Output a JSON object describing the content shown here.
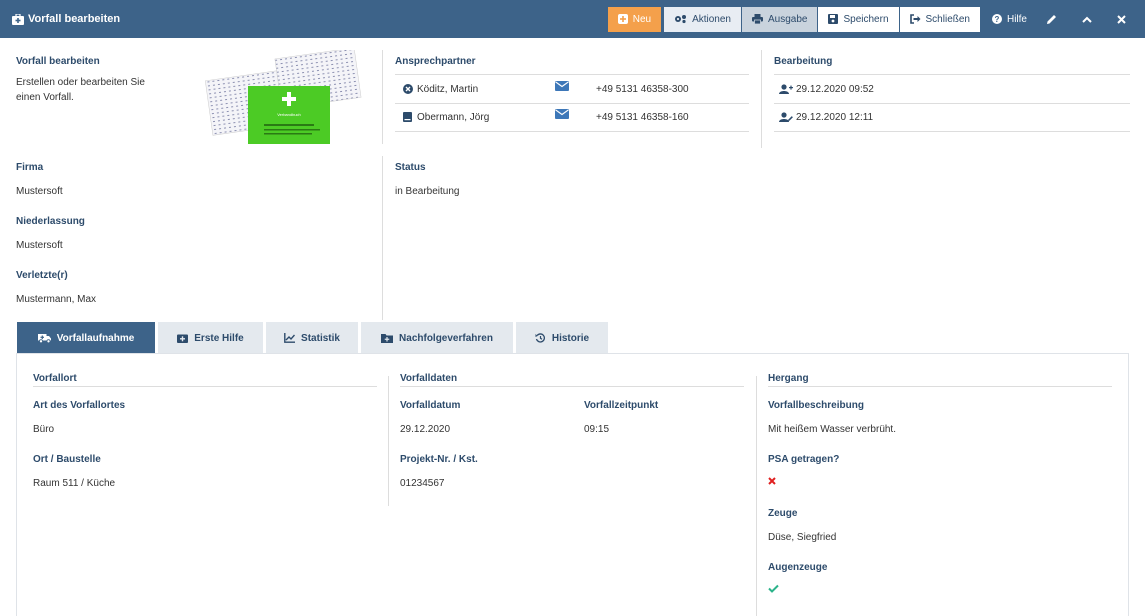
{
  "window": {
    "title": "Vorfall bearbeiten"
  },
  "toolbar": {
    "new_label": "Neu",
    "actions_label": "Aktionen",
    "output_label": "Ausgabe",
    "save_label": "Speichern",
    "close_label": "Schließen",
    "help_label": "Hilfe"
  },
  "intro": {
    "heading": "Vorfall bearbeiten",
    "description": "Erstellen oder bearbeiten Sie einen Vorfall.",
    "book_label": "Verbandbuch"
  },
  "contacts": {
    "heading": "Ansprechpartner",
    "items": [
      {
        "name": "Köditz, Martin",
        "phone": "+49 5131 46358-300"
      },
      {
        "name": "Obermann, Jörg",
        "phone": "+49 5131 46358-160"
      }
    ]
  },
  "editing": {
    "heading": "Bearbeitung",
    "created": "29.12.2020 09:52",
    "modified": "29.12.2020 12:11"
  },
  "company": {
    "firma_label": "Firma",
    "firma_value": "Mustersoft",
    "niederlassung_label": "Niederlassung",
    "niederlassung_value": "Mustersoft",
    "verletzte_label": "Verletzte(r)",
    "verletzte_value": "Mustermann, Max"
  },
  "status": {
    "label": "Status",
    "value": "in Bearbeitung"
  },
  "tabs": [
    {
      "label": "Vorfallaufnahme"
    },
    {
      "label": "Erste Hilfe"
    },
    {
      "label": "Statistik"
    },
    {
      "label": "Nachfolgeverfahren"
    },
    {
      "label": "Historie"
    }
  ],
  "vorfallort": {
    "heading": "Vorfallort",
    "art_label": "Art des Vorfallortes",
    "art_value": "Büro",
    "ort_label": "Ort / Baustelle",
    "ort_value": "Raum 511 / Küche"
  },
  "vorfalldaten": {
    "heading": "Vorfalldaten",
    "datum_label": "Vorfalldatum",
    "datum_value": "29.12.2020",
    "zeit_label": "Vorfallzeitpunkt",
    "zeit_value": "09:15",
    "projekt_label": "Projekt-Nr. / Kst.",
    "projekt_value": "01234567"
  },
  "hergang": {
    "heading": "Hergang",
    "beschreibung_label": "Vorfallbeschreibung",
    "beschreibung_value": "Mit heißem Wasser verbrüht.",
    "psa_label": "PSA getragen?",
    "psa_value": false,
    "zeuge_label": "Zeuge",
    "zeuge_value": "Düse, Siegfried",
    "augenzeuge_label": "Augenzeuge",
    "augenzeuge_value": true
  },
  "colors": {
    "header": "#3d6389",
    "accent_new": "#f4a04b",
    "link": "#2d4b6b",
    "no": "#e02020",
    "yes": "#2bb38a"
  }
}
